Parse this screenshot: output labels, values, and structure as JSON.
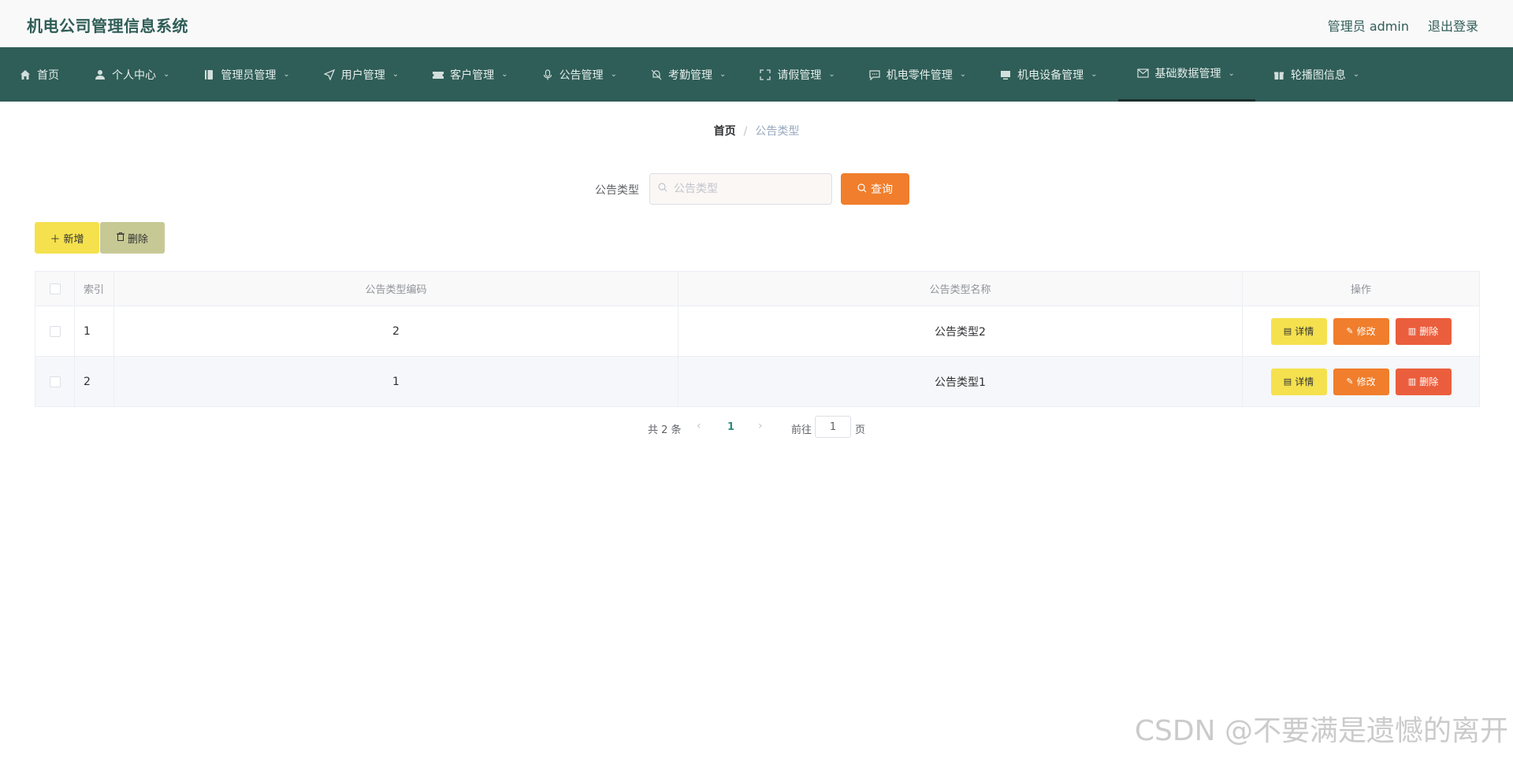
{
  "header": {
    "title": "机电公司管理信息系统",
    "user_label": "管理员 admin",
    "logout_label": "退出登录"
  },
  "nav": {
    "items": [
      {
        "label": "首页",
        "icon": "home-icon",
        "has_dropdown": false
      },
      {
        "label": "个人中心",
        "icon": "user-icon",
        "has_dropdown": true
      },
      {
        "label": "管理员管理",
        "icon": "book-icon",
        "has_dropdown": true
      },
      {
        "label": "用户管理",
        "icon": "send-icon",
        "has_dropdown": true
      },
      {
        "label": "客户管理",
        "icon": "ticket-icon",
        "has_dropdown": true
      },
      {
        "label": "公告管理",
        "icon": "microphone-icon",
        "has_dropdown": true
      },
      {
        "label": "考勤管理",
        "icon": "bell-off-icon",
        "has_dropdown": true
      },
      {
        "label": "请假管理",
        "icon": "fullscreen-icon",
        "has_dropdown": true
      },
      {
        "label": "机电零件管理",
        "icon": "chat-icon",
        "has_dropdown": true
      },
      {
        "label": "机电设备管理",
        "icon": "monitor-icon",
        "has_dropdown": true
      },
      {
        "label": "基础数据管理",
        "icon": "mail-icon",
        "has_dropdown": true,
        "active": true
      },
      {
        "label": "轮播图信息",
        "icon": "gift-icon",
        "has_dropdown": true
      }
    ]
  },
  "breadcrumb": {
    "home": "首页",
    "separator": "/",
    "current": "公告类型"
  },
  "search": {
    "label": "公告类型",
    "placeholder": "公告类型",
    "value": "",
    "button_label": "查询"
  },
  "toolbar": {
    "add_label": "新增",
    "delete_label": "删除"
  },
  "table": {
    "columns": [
      "索引",
      "公告类型编码",
      "公告类型名称",
      "操作"
    ],
    "rows": [
      {
        "index": "1",
        "code": "2",
        "name": "公告类型2"
      },
      {
        "index": "2",
        "code": "1",
        "name": "公告类型1"
      }
    ],
    "actions": {
      "detail": "详情",
      "edit": "修改",
      "remove": "删除"
    }
  },
  "pagination": {
    "total_text": "共 2 条",
    "current_page": "1",
    "goto_label": "前往",
    "goto_value": "1",
    "page_suffix": "页"
  },
  "watermark": "CSDN @不要满是遗憾的离开",
  "colors": {
    "nav_bg": "#2f5d57",
    "title": "#2f5d57",
    "query_button": "#f07e2c",
    "add_button": "#f5e14e",
    "delete_button": "#c7c995",
    "detail_button": "#f5e14e",
    "edit_button": "#f07e2c",
    "remove_button": "#eb5e3d"
  }
}
